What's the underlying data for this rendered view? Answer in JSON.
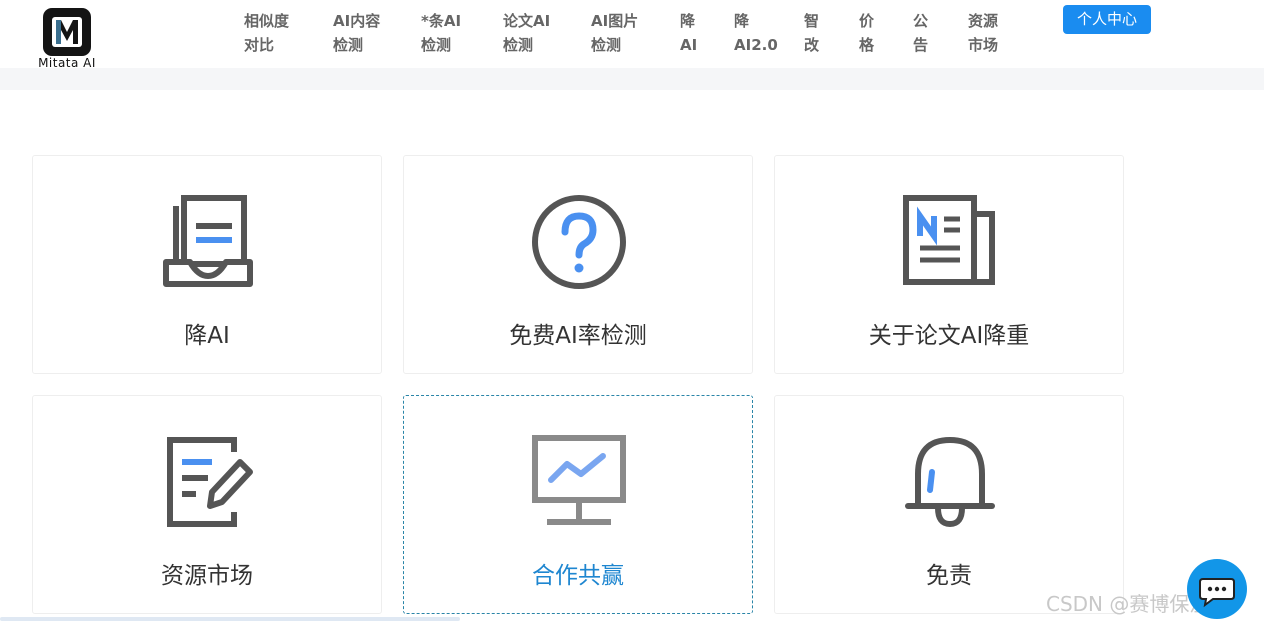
{
  "logo": {
    "text": "Mitata AI"
  },
  "nav": [
    {
      "line1": "相似度",
      "line2": "对比"
    },
    {
      "line1": "AI内容",
      "line2": "检测"
    },
    {
      "line1": "*条AI",
      "line2": "检测"
    },
    {
      "line1": "论文AI",
      "line2": "检测"
    },
    {
      "line1": "AI图片",
      "line2": "检测"
    },
    {
      "line1": "降",
      "line2": "AI"
    },
    {
      "line1": "降",
      "line2": "AI2.0"
    },
    {
      "line1": "智",
      "line2": "改"
    },
    {
      "line1": "价",
      "line2": "格"
    },
    {
      "line1": "公",
      "line2": "告"
    },
    {
      "line1": "资源",
      "line2": "市场"
    }
  ],
  "user_center": "个人中心",
  "cards": [
    {
      "label": "降AI",
      "icon": "inbox-document-icon"
    },
    {
      "label": "免费AI率检测",
      "icon": "question-circle-icon"
    },
    {
      "label": "关于论文AI降重",
      "icon": "newspaper-icon"
    },
    {
      "label": "资源市场",
      "icon": "edit-document-icon"
    },
    {
      "label": "合作共赢",
      "icon": "presentation-chart-icon",
      "active": true
    },
    {
      "label": "免责",
      "icon": "bell-icon"
    }
  ],
  "watermark": "CSDN @赛博保温杯",
  "colors": {
    "accent": "#1a8cf0",
    "icon_gray": "#555555",
    "icon_blue": "#4a90f0",
    "active_border": "#2a85a8"
  }
}
